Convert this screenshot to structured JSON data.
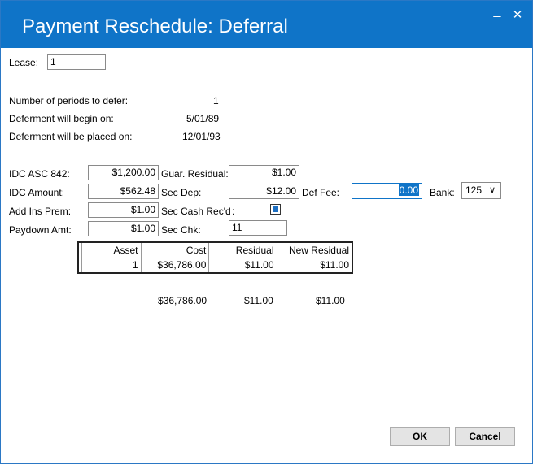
{
  "window": {
    "title": "Payment Reschedule: Deferral",
    "minimize_glyph": "_",
    "close_glyph": "✕"
  },
  "lease": {
    "label": "Lease:",
    "value": "1"
  },
  "info": [
    {
      "label": "Number of periods to defer:",
      "value": "1"
    },
    {
      "label": "Deferment will begin on:",
      "value": "5/01/89"
    },
    {
      "label": "Deferment will be placed on:",
      "value": "12/01/93"
    }
  ],
  "fields": {
    "idc_asc": {
      "label": "IDC ASC 842:",
      "value": "$1,200.00"
    },
    "idc_amount": {
      "label": "IDC Amount:",
      "value": "$562.48"
    },
    "add_ins_prem": {
      "label": "Add Ins Prem:",
      "value": "$1.00"
    },
    "paydown_amt": {
      "label": "Paydown Amt:",
      "value": "$1.00"
    },
    "guar_residual": {
      "label": "Guar. Residual:",
      "value": "$1.00"
    },
    "sec_dep": {
      "label": "Sec Dep:",
      "value": "$12.00"
    },
    "sec_cash_recd": {
      "label": "Sec Cash Rec'd",
      "colon": ":",
      "checked": true
    },
    "sec_chk": {
      "label": "Sec Chk:",
      "value": "11"
    },
    "def_fee": {
      "label": "Def Fee:",
      "value": "0.00"
    },
    "bank": {
      "label": "Bank:",
      "value": "125"
    }
  },
  "grid": {
    "columns": [
      "Asset",
      "Cost",
      "Residual",
      "New Residual"
    ],
    "rows": [
      [
        "1",
        "$36,786.00",
        "$11.00",
        "$11.00"
      ]
    ],
    "totals": {
      "cost": "$36,786.00",
      "residual": "$11.00",
      "new_residual": "$11.00"
    }
  },
  "buttons": {
    "ok": "OK",
    "cancel": "Cancel"
  },
  "colors": {
    "titlebar": "#0f74c8",
    "accent": "#1d6fc2"
  }
}
